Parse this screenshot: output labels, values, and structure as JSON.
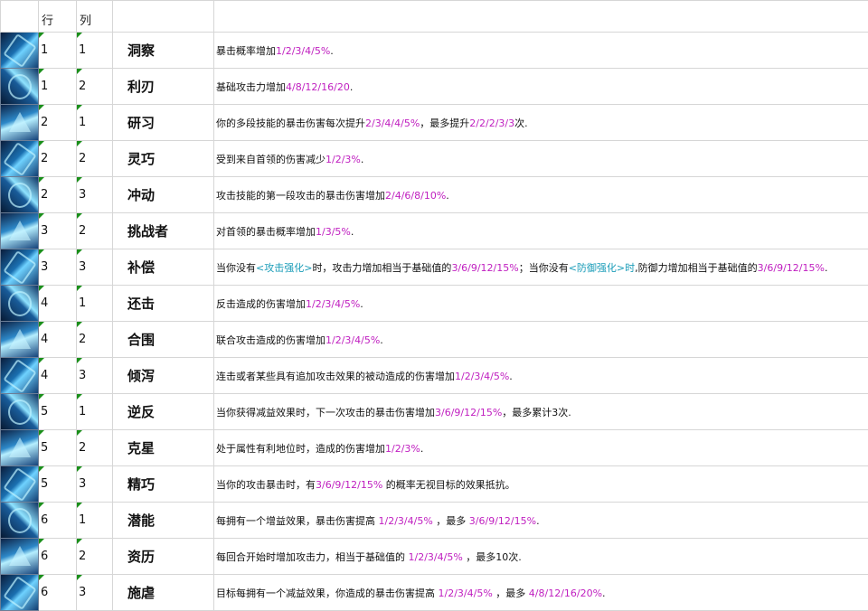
{
  "header": {
    "icon": "",
    "row": "行",
    "col": "列",
    "name": "",
    "desc": ""
  },
  "rows": [
    {
      "row": "1",
      "col": "1",
      "name": "洞察",
      "icon": "eye-icon",
      "desc": [
        {
          "t": "暴击概率增加"
        },
        {
          "t": "1/2/3/4/5%",
          "c": "v"
        },
        {
          "t": "."
        }
      ]
    },
    {
      "row": "1",
      "col": "2",
      "name": "利刃",
      "icon": "blade-icon",
      "desc": [
        {
          "t": "基础攻击力增加"
        },
        {
          "t": "4/8/12/16/20",
          "c": "v"
        },
        {
          "t": "."
        }
      ]
    },
    {
      "row": "2",
      "col": "1",
      "name": "研习",
      "icon": "study-icon",
      "desc": [
        {
          "t": "你的多段技能的暴击伤害每次提升"
        },
        {
          "t": "2/3/4/4/5%",
          "c": "v"
        },
        {
          "t": "，最多提升"
        },
        {
          "t": "2/2/2/3/3",
          "c": "v"
        },
        {
          "t": "次."
        }
      ]
    },
    {
      "row": "2",
      "col": "2",
      "name": "灵巧",
      "icon": "runner-icon",
      "desc": [
        {
          "t": "受到来自首领的伤害减少"
        },
        {
          "t": "1/2/3%",
          "c": "v"
        },
        {
          "t": "."
        }
      ]
    },
    {
      "row": "2",
      "col": "3",
      "name": "冲动",
      "icon": "impulse-icon",
      "desc": [
        {
          "t": "攻击技能的第一段攻击的暴击伤害增加"
        },
        {
          "t": "2/4/6/8/10%",
          "c": "v"
        },
        {
          "t": "."
        }
      ]
    },
    {
      "row": "3",
      "col": "2",
      "name": "挑战者",
      "icon": "fist-icon",
      "desc": [
        {
          "t": "对首领的暴击概率增加"
        },
        {
          "t": "1/3/5%",
          "c": "v"
        },
        {
          "t": "."
        }
      ]
    },
    {
      "row": "3",
      "col": "3",
      "name": "补偿",
      "icon": "puzzle-icon",
      "desc": [
        {
          "t": "当你没有"
        },
        {
          "t": "<攻击强化>",
          "c": "k"
        },
        {
          "t": "时，攻击力增加相当于基础值的"
        },
        {
          "t": "3/6/9/12/15%",
          "c": "v"
        },
        {
          "t": "；当你没有"
        },
        {
          "t": "<防御强化>时",
          "c": "k"
        },
        {
          "t": ",防御力增加相当于基础值的"
        },
        {
          "t": "3/6/9/12/15%",
          "c": "v"
        },
        {
          "t": "."
        }
      ]
    },
    {
      "row": "4",
      "col": "1",
      "name": "还击",
      "icon": "counter-icon",
      "desc": [
        {
          "t": "反击造成的伤害增加"
        },
        {
          "t": "1/2/3/4/5%",
          "c": "v"
        },
        {
          "t": "."
        }
      ]
    },
    {
      "row": "4",
      "col": "2",
      "name": "合围",
      "icon": "target-icon",
      "desc": [
        {
          "t": "联合攻击造成的伤害增加"
        },
        {
          "t": "1/2/3/4/5%",
          "c": "v"
        },
        {
          "t": "."
        }
      ]
    },
    {
      "row": "4",
      "col": "3",
      "name": "倾泻",
      "icon": "burst-icon",
      "desc": [
        {
          "t": "连击或者某些具有追加攻击效果的被动造成的伤害增加"
        },
        {
          "t": "1/2/3/4/5%",
          "c": "v"
        },
        {
          "t": "."
        }
      ]
    },
    {
      "row": "5",
      "col": "1",
      "name": "逆反",
      "icon": "rebel-icon",
      "desc": [
        {
          "t": "当你获得减益效果时，下一次攻击的暴击伤害增加"
        },
        {
          "t": "3/6/9/12/15%",
          "c": "v"
        },
        {
          "t": "，最多累计3次."
        }
      ]
    },
    {
      "row": "5",
      "col": "2",
      "name": "克星",
      "icon": "nemesis-icon",
      "desc": [
        {
          "t": "处于属性有利地位时，造成的伤害增加"
        },
        {
          "t": "1/2/3%",
          "c": "v"
        },
        {
          "t": "."
        }
      ]
    },
    {
      "row": "5",
      "col": "3",
      "name": "精巧",
      "icon": "finesse-icon",
      "desc": [
        {
          "t": "当你的攻击暴击时，有"
        },
        {
          "t": "3/6/9/12/15%",
          "c": "v"
        },
        {
          "t": " 的概率无视目标的效果抵抗。"
        }
      ]
    },
    {
      "row": "6",
      "col": "1",
      "name": "潜能",
      "icon": "potential-icon",
      "desc": [
        {
          "t": "每拥有一个增益效果，暴击伤害提高 "
        },
        {
          "t": "1/2/3/4/5%",
          "c": "v"
        },
        {
          "t": " ，最多 "
        },
        {
          "t": "3/6/9/12/15%",
          "c": "v"
        },
        {
          "t": "."
        }
      ]
    },
    {
      "row": "6",
      "col": "2",
      "name": "资历",
      "icon": "seniority-icon",
      "desc": [
        {
          "t": "每回合开始时增加攻击力，相当于基础值的 "
        },
        {
          "t": "1/2/3/4/5%",
          "c": "v"
        },
        {
          "t": " ，最多10次."
        }
      ]
    },
    {
      "row": "6",
      "col": "3",
      "name": "施虐",
      "icon": "sadist-icon",
      "desc": [
        {
          "t": "目标每拥有一个减益效果，你造成的暴击伤害提高 "
        },
        {
          "t": "1/2/3/4/5%",
          "c": "v"
        },
        {
          "t": " ，最多 "
        },
        {
          "t": "4/8/12/16/20%",
          "c": "v"
        },
        {
          "t": "."
        }
      ]
    }
  ]
}
